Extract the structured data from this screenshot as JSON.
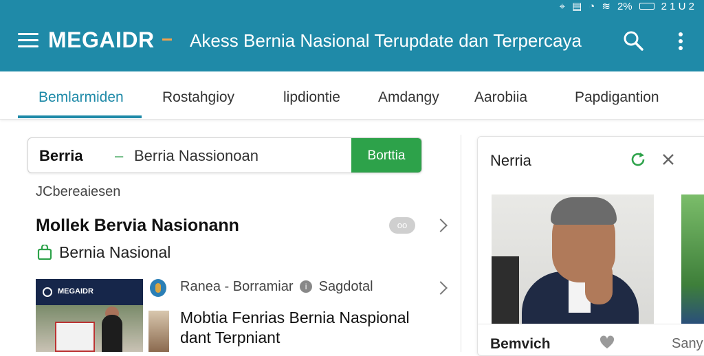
{
  "statusbar": {
    "battery": "2%",
    "time": "2 1 U 2"
  },
  "header": {
    "brand": "MEGAIDR",
    "tagline": "Akess Bernia Nasional Terupdate dan Terpercaya"
  },
  "tabs": [
    {
      "label": "Bemlarmiden",
      "active": true
    },
    {
      "label": "Rostahgioy",
      "active": false
    },
    {
      "label": "lipdiontie",
      "active": false
    },
    {
      "label": "Amdangy",
      "active": false
    },
    {
      "label": "Aarobiia",
      "active": false
    },
    {
      "label": "Papdigantion",
      "active": false
    }
  ],
  "search": {
    "strong": "Berria",
    "separator": "–",
    "value": "Berria Nassionoan",
    "button": "Borttia"
  },
  "main": {
    "section_label": "JCbereaiesen",
    "headline": "Mollek Bervia Nasionann",
    "badge": "oo",
    "subline": "Bernia Nasional",
    "article": {
      "thumb_brand": "MEGAIDR",
      "source": "Ranea",
      "source_sep": "-",
      "source_name": "Borramiar",
      "source_info": "i",
      "source_tag": "Sagdotal",
      "title": "Mobtia Fenrias Bernia Naspional dant Terpniant"
    }
  },
  "panel": {
    "title": "Nerria",
    "caption": "Bemvich",
    "more": "Sany"
  },
  "colors": {
    "appbar": "#1f8aa8",
    "accent": "#1f8aa8",
    "button_green": "#2da24a",
    "brand_dash": "#f4a24b"
  },
  "icons": [
    "menu-icon",
    "search-icon",
    "more-vertical-icon",
    "bag-icon",
    "chevron-right-icon",
    "info-icon",
    "refresh-icon",
    "close-icon",
    "heart-icon"
  ]
}
